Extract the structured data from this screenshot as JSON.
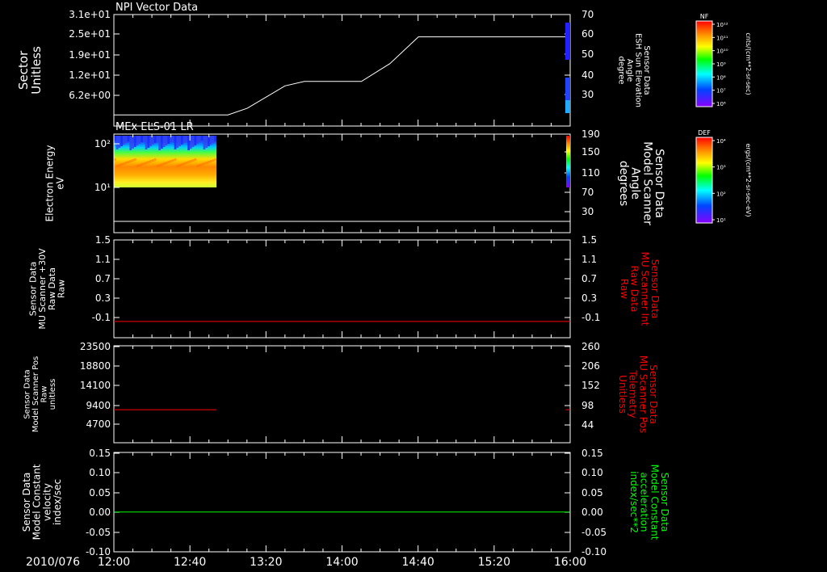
{
  "figure": {
    "date_label": "2010/076",
    "time_ticks": [
      "12:00",
      "12:40",
      "13:20",
      "14:00",
      "14:40",
      "15:20",
      "16:00"
    ]
  },
  "colors": {
    "background": "#000000",
    "axis": "#ffffff",
    "trace_white": "#ffffff",
    "trace_red": "#ff0000",
    "trace_green": "#00ff00"
  },
  "colorbars": [
    {
      "title": "NF",
      "unit": "cnts/(cm**2-sr-sec)",
      "ticks": [
        "10¹²",
        "10¹¹",
        "10¹⁰",
        "10⁹",
        "10⁸",
        "10⁷",
        "10⁶"
      ]
    },
    {
      "title": "DEF",
      "unit": "ergs/(cm**2-sr-sec-eV)",
      "ticks": [
        "10⁴",
        "10³",
        "10²",
        "10¹"
      ]
    }
  ],
  "chart_data": [
    {
      "type": "line",
      "title": "NPI Vector Data",
      "ylabel": [
        "Sector",
        "Unitless"
      ],
      "yticks": [
        "3.1e+01",
        "2.5e+01",
        "1.9e+01",
        "1.2e+01",
        "6.2e+00"
      ],
      "ylabel_right": [
        "Sensor Data",
        "ESH Sun Elevation",
        "Angle",
        "degree"
      ],
      "yticks_right": [
        "70",
        "60",
        "50",
        "40",
        "30"
      ],
      "ylim_right": [
        20,
        70
      ],
      "series": [
        {
          "values_x_hours": [
            12.0,
            13.0,
            13.17,
            13.5,
            13.67,
            14.17,
            14.42,
            14.67,
            15.0,
            16.0
          ],
          "values_y": [
            25,
            25,
            28,
            38,
            40,
            40,
            48,
            60,
            60,
            60
          ]
        }
      ]
    },
    {
      "type": "heatmap",
      "title": "MEx ELS-01 LR",
      "ylabel": [
        "Electron Energy",
        "eV"
      ],
      "yticks": [
        "10²",
        "10¹"
      ],
      "ylabel_right": [
        "Sensor Data",
        "Model Scanner",
        "Angle",
        "degrees"
      ],
      "yticks_right": [
        "190",
        "150",
        "110",
        "70",
        "30"
      ],
      "ylim_right": [
        0,
        190
      ],
      "data_interval_hours": [
        12.0,
        12.9
      ],
      "series": [
        {
          "values_x_hours": [
            12.0,
            16.0
          ],
          "values_y": [
            10,
            10
          ]
        }
      ]
    },
    {
      "type": "line",
      "ylabel": [
        "Sensor Data",
        "MU Scanner +30V",
        "Raw Data",
        "Raw"
      ],
      "yticks": [
        "1.5",
        "1.1",
        "0.7",
        "0.3",
        "-0.1"
      ],
      "ylim": [
        -0.3,
        1.5
      ],
      "ylabel_right": [
        "Sensor Data",
        "MU Scanner Int",
        "Raw Data",
        "Raw"
      ],
      "yticks_right": [
        "1.5",
        "1.1",
        "0.7",
        "0.3",
        "-0.1"
      ],
      "series": [
        {
          "values_x_hours": [
            12.0,
            16.0
          ],
          "values_y": [
            0.0,
            0.0
          ]
        }
      ]
    },
    {
      "type": "line",
      "ylabel": [
        "Sensor Data",
        "Model Scanner Pos",
        "Raw",
        "unitless"
      ],
      "yticks": [
        "23500",
        "18800",
        "14100",
        "9400",
        "4700"
      ],
      "ylim": [
        0,
        23500
      ],
      "ylabel_right": [
        "Sensor Data",
        "MU Scanner Pos",
        "Telemetry",
        "Unitless"
      ],
      "yticks_right": [
        "260",
        "206",
        "152",
        "98",
        "44"
      ],
      "series": [
        {
          "values_x_hours": [
            12.0,
            12.9
          ],
          "values_y": [
            8000,
            8000
          ]
        },
        {
          "values_x_hours": [
            15.96,
            16.0
          ],
          "values_y": [
            8000,
            8000
          ]
        }
      ]
    },
    {
      "type": "line",
      "ylabel": [
        "Sensor Data",
        "Model Constant",
        "velocity",
        "index/sec"
      ],
      "yticks": [
        "0.15",
        "0.10",
        "0.05",
        "0.00",
        "-0.05",
        "-0.10"
      ],
      "ylim": [
        -0.1,
        0.15
      ],
      "ylabel_right": [
        "Sensor Data",
        "Model Constant",
        "acceleration",
        "index/sec**2"
      ],
      "yticks_right": [
        "0.15",
        "0.10",
        "0.05",
        "0.00",
        "-0.05",
        "-0.10"
      ],
      "series": [
        {
          "values_x_hours": [
            12.0,
            16.0
          ],
          "values_y": [
            0.0,
            0.0
          ]
        }
      ]
    }
  ]
}
